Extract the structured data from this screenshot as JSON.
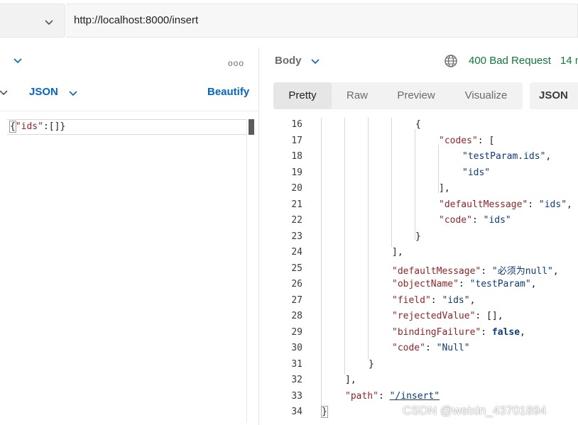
{
  "url_bar": {
    "url": "http://localhost:8000/insert",
    "method_chevron_icon": "chevron-down-icon"
  },
  "request": {
    "more_icon": "more-horizontal-icon",
    "body_format": "JSON",
    "beautify_label": "Beautify",
    "editor_text_parts": [
      "{",
      "\"ids\"",
      ":[]}"
    ]
  },
  "response": {
    "section_label": "Body",
    "status": "400 Bad Request",
    "time_partial": "14 m",
    "globe_icon": "globe-icon",
    "tabs": [
      "Pretty",
      "Raw",
      "Preview",
      "Visualize"
    ],
    "active_tab": "Pretty",
    "format": "JSON",
    "lines": [
      {
        "n": "16",
        "indent": 16,
        "tokens": [
          {
            "t": "p",
            "v": "{"
          }
        ]
      },
      {
        "n": "17",
        "indent": 20,
        "tokens": [
          {
            "t": "key",
            "v": "\"codes\""
          },
          {
            "t": "p",
            "v": ": ["
          }
        ]
      },
      {
        "n": "18",
        "indent": 24,
        "tokens": [
          {
            "t": "str",
            "v": "\"testParam.ids\""
          },
          {
            "t": "p",
            "v": ","
          }
        ]
      },
      {
        "n": "19",
        "indent": 24,
        "tokens": [
          {
            "t": "str",
            "v": "\"ids\""
          }
        ]
      },
      {
        "n": "20",
        "indent": 20,
        "tokens": [
          {
            "t": "p",
            "v": "],"
          }
        ]
      },
      {
        "n": "21",
        "indent": 20,
        "tokens": [
          {
            "t": "key",
            "v": "\"defaultMessage\""
          },
          {
            "t": "p",
            "v": ": "
          },
          {
            "t": "str",
            "v": "\"ids\""
          },
          {
            "t": "p",
            "v": ","
          }
        ]
      },
      {
        "n": "22",
        "indent": 20,
        "tokens": [
          {
            "t": "key",
            "v": "\"code\""
          },
          {
            "t": "p",
            "v": ": "
          },
          {
            "t": "str",
            "v": "\"ids\""
          }
        ]
      },
      {
        "n": "23",
        "indent": 16,
        "tokens": [
          {
            "t": "p",
            "v": "}"
          }
        ]
      },
      {
        "n": "24",
        "indent": 12,
        "tokens": [
          {
            "t": "p",
            "v": "],"
          }
        ]
      },
      {
        "n": "25",
        "indent": 12,
        "tokens": [
          {
            "t": "key",
            "v": "\"defaultMessage\""
          },
          {
            "t": "p",
            "v": ": "
          },
          {
            "t": "str",
            "v": "\"必须为null\""
          },
          {
            "t": "p",
            "v": ","
          }
        ]
      },
      {
        "n": "26",
        "indent": 12,
        "tokens": [
          {
            "t": "key",
            "v": "\"objectName\""
          },
          {
            "t": "p",
            "v": ": "
          },
          {
            "t": "str",
            "v": "\"testParam\""
          },
          {
            "t": "p",
            "v": ","
          }
        ]
      },
      {
        "n": "27",
        "indent": 12,
        "tokens": [
          {
            "t": "key",
            "v": "\"field\""
          },
          {
            "t": "p",
            "v": ": "
          },
          {
            "t": "str",
            "v": "\"ids\""
          },
          {
            "t": "p",
            "v": ","
          }
        ]
      },
      {
        "n": "28",
        "indent": 12,
        "tokens": [
          {
            "t": "key",
            "v": "\"rejectedValue\""
          },
          {
            "t": "p",
            "v": ": [],"
          }
        ]
      },
      {
        "n": "29",
        "indent": 12,
        "tokens": [
          {
            "t": "key",
            "v": "\"bindingFailure\""
          },
          {
            "t": "p",
            "v": ": "
          },
          {
            "t": "kw",
            "v": "false"
          },
          {
            "t": "p",
            "v": ","
          }
        ]
      },
      {
        "n": "30",
        "indent": 12,
        "tokens": [
          {
            "t": "key",
            "v": "\"code\""
          },
          {
            "t": "p",
            "v": ": "
          },
          {
            "t": "str",
            "v": "\"Null\""
          }
        ]
      },
      {
        "n": "31",
        "indent": 8,
        "tokens": [
          {
            "t": "p",
            "v": "}"
          }
        ]
      },
      {
        "n": "32",
        "indent": 4,
        "tokens": [
          {
            "t": "p",
            "v": "],"
          }
        ]
      },
      {
        "n": "33",
        "indent": 4,
        "tokens": [
          {
            "t": "key",
            "v": "\"path\""
          },
          {
            "t": "p",
            "v": ": "
          },
          {
            "t": "link",
            "v": "\"/insert\""
          }
        ]
      },
      {
        "n": "34",
        "indent": 0,
        "tokens": [
          {
            "t": "p",
            "v": "}"
          }
        ]
      }
    ]
  },
  "watermark": "CSDN @weixin_43701894",
  "colors": {
    "accent_blue": "#0265d2",
    "status_green": "#0e7a3a",
    "json_key": "#9c1f1f",
    "json_string": "#0b3a8f"
  }
}
